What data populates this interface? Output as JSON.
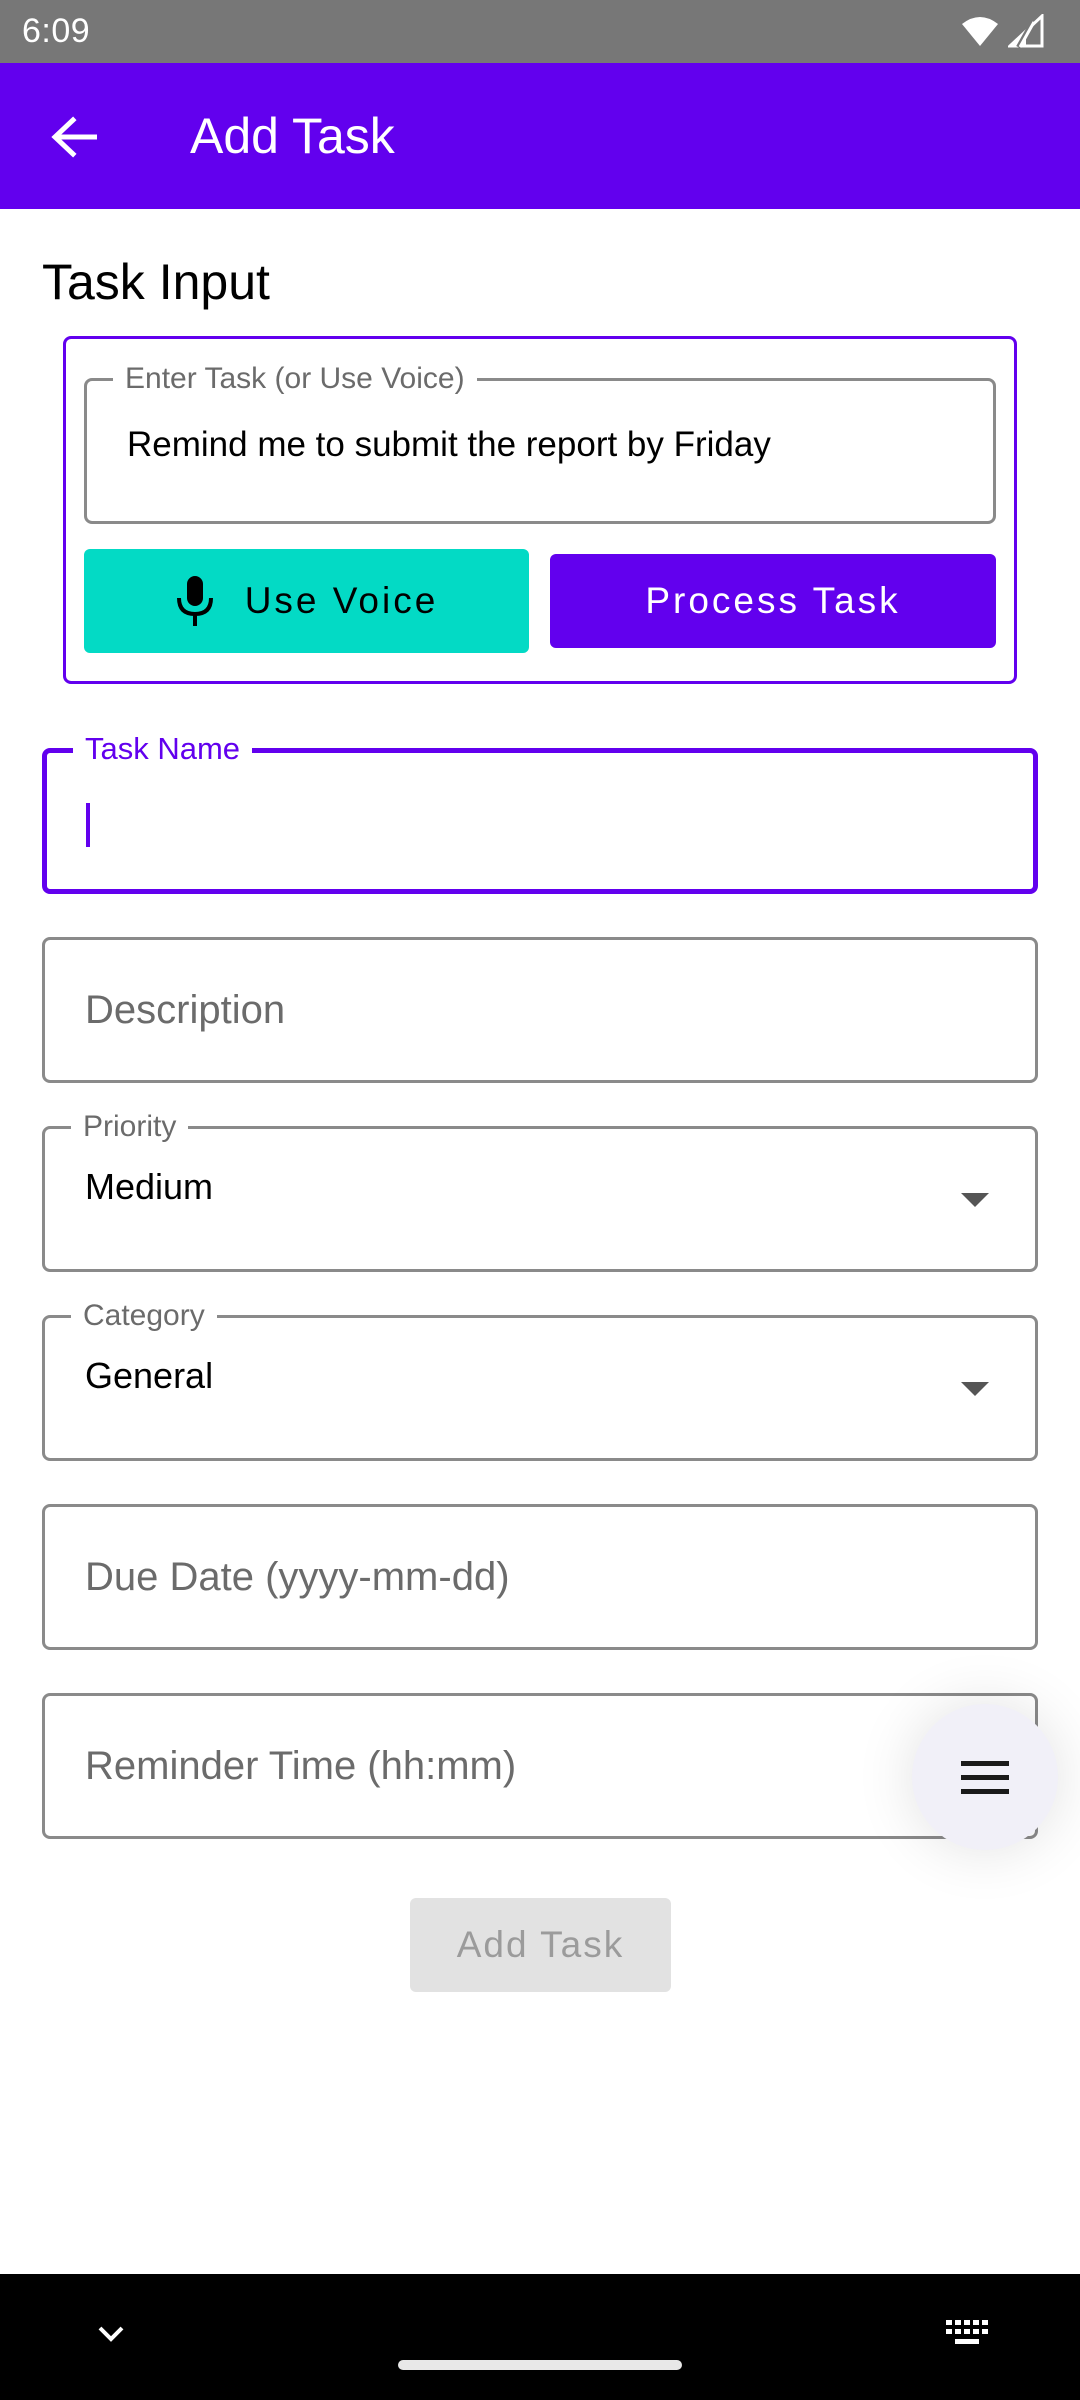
{
  "status_bar": {
    "time": "6:09",
    "icons": [
      "wifi-icon",
      "signal-icon"
    ]
  },
  "app_bar": {
    "title": "Add Task",
    "back_icon": "arrow-back-icon",
    "color": "#6200EE"
  },
  "task_input": {
    "section_title": "Task Input",
    "voice_field": {
      "label": "Enter Task (or Use Voice)",
      "value": "Remind me to submit the report by Friday"
    },
    "use_voice_button": {
      "label": "Use Voice",
      "icon": "mic-icon",
      "color": "#03DAC5"
    },
    "process_task_button": {
      "label": "Process Task",
      "color": "#6200EE"
    }
  },
  "form": {
    "task_name": {
      "label": "Task Name",
      "value": ""
    },
    "description": {
      "placeholder": "Description"
    },
    "priority": {
      "label": "Priority",
      "selected": "Medium"
    },
    "category": {
      "label": "Category",
      "selected": "General"
    },
    "due_date": {
      "placeholder": "Due Date (yyyy-mm-dd)"
    },
    "reminder_time": {
      "placeholder": "Reminder Time (hh:mm)"
    },
    "add_task_button": {
      "label": "Add Task",
      "enabled": false
    }
  },
  "fab": {
    "icon": "menu-icon"
  },
  "nav_bar": {
    "left_icon": "chevron-down-icon",
    "right_icon": "keyboard-icon"
  }
}
